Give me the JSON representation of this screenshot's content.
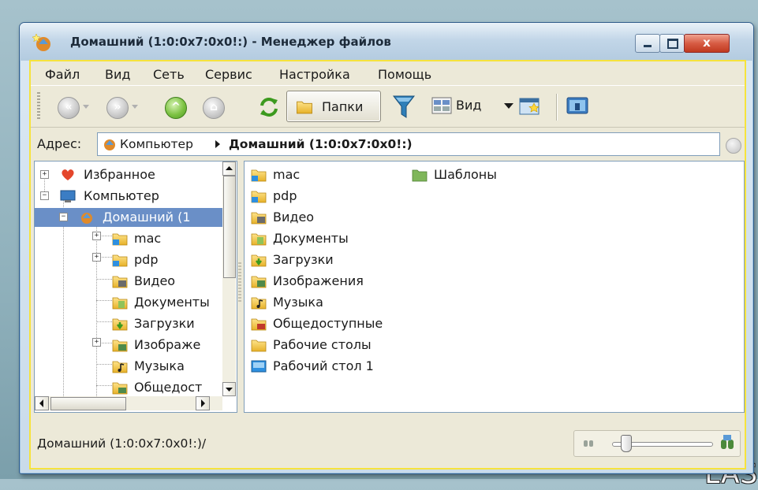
{
  "window": {
    "title": "Домашний (1:0:0x7:0x0!:) - Менеджер файлов",
    "close_glyph": "x"
  },
  "menu": {
    "items": [
      "Файл",
      "Вид",
      "Сеть",
      "Сервис",
      "Настройка",
      "Помощь"
    ]
  },
  "toolbar": {
    "back_glyph": "«",
    "forward_glyph": "»",
    "up_glyph": "^",
    "home_glyph": "⌂",
    "folders_label": "Папки",
    "view_label": "Вид",
    "icons": [
      "back-icon",
      "forward-icon",
      "up-icon",
      "home-icon",
      "refresh-icon",
      "folder-icon",
      "filter-icon",
      "view-icon",
      "new-window-icon",
      "terminal-icon"
    ]
  },
  "address": {
    "label": "Адрес:",
    "computer": "Компьютер",
    "current": "Домашний (1:0:0x7:0x0!:)"
  },
  "tree": {
    "items": [
      {
        "label": "Избранное",
        "icon": "heart-icon"
      },
      {
        "label": "Компьютер",
        "icon": "computer-icon"
      },
      {
        "label": "Домашний (1",
        "icon": "home-folder-icon",
        "selected": true
      },
      {
        "label": "mac",
        "icon": "linked-folder-icon"
      },
      {
        "label": "pdp",
        "icon": "linked-folder-icon"
      },
      {
        "label": "Видео",
        "icon": "video-folder-icon"
      },
      {
        "label": "Документы",
        "icon": "documents-folder-icon"
      },
      {
        "label": "Загрузки",
        "icon": "downloads-folder-icon"
      },
      {
        "label": "Изображе",
        "icon": "pictures-folder-icon"
      },
      {
        "label": "Музыка",
        "icon": "music-folder-icon"
      },
      {
        "label": "Общедост",
        "icon": "public-folder-icon"
      }
    ]
  },
  "files": {
    "items": [
      {
        "label": "mac",
        "icon": "linked-folder-icon"
      },
      {
        "label": "pdp",
        "icon": "linked-folder-icon"
      },
      {
        "label": "Видео",
        "icon": "video-folder-icon"
      },
      {
        "label": "Документы",
        "icon": "documents-folder-icon"
      },
      {
        "label": "Загрузки",
        "icon": "downloads-folder-icon"
      },
      {
        "label": "Изображения",
        "icon": "pictures-folder-icon"
      },
      {
        "label": "Музыка",
        "icon": "music-folder-icon"
      },
      {
        "label": "Общедоступные",
        "icon": "public-folder-icon"
      },
      {
        "label": "Рабочие столы",
        "icon": "folder-icon"
      },
      {
        "label": "Рабочий стол 1",
        "icon": "desktop-link-icon"
      },
      {
        "label": "Шаблоны",
        "icon": "templates-folder-icon"
      }
    ]
  },
  "status": {
    "path": "Домашний (1:0:0x7:0x0!:)/",
    "zoom_level": 0.1
  },
  "desktop_fragment": "LAS"
}
